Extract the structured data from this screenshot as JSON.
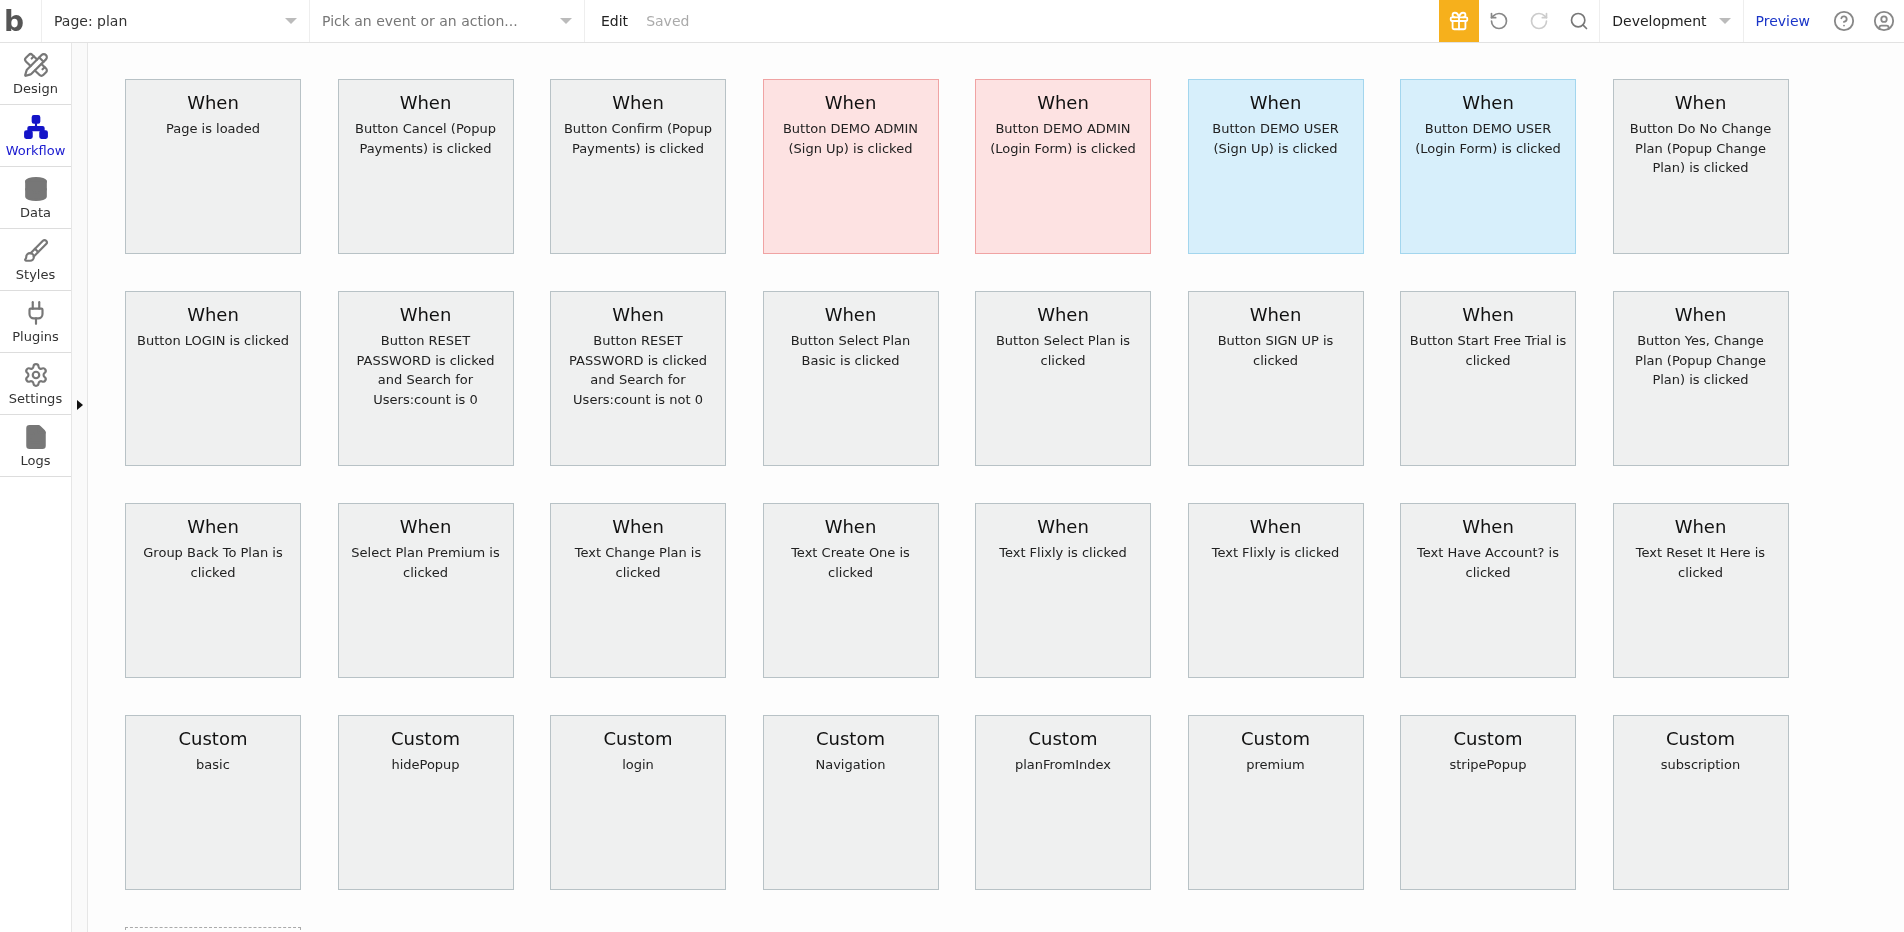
{
  "topbar": {
    "logo": "b",
    "page_selector": "Page: plan",
    "event_picker": {
      "placeholder": "Pick an event or an action..."
    },
    "edit": "Edit",
    "status": "Saved",
    "environment": "Development",
    "preview": "Preview"
  },
  "sidebar": {
    "items": [
      {
        "label": "Design",
        "selected": false
      },
      {
        "label": "Workflow",
        "selected": true
      },
      {
        "label": "Data",
        "selected": false
      },
      {
        "label": "Styles",
        "selected": false
      },
      {
        "label": "Plugins",
        "selected": false
      },
      {
        "label": "Settings",
        "selected": false
      },
      {
        "label": "Logs",
        "selected": false
      }
    ]
  },
  "events": [
    {
      "heading": "When",
      "text": "Page is loaded",
      "color": "#eff0f0"
    },
    {
      "heading": "When",
      "text": "Button Cancel (Popup Payments) is clicked",
      "color": "#eff0f0"
    },
    {
      "heading": "When",
      "text": "Button Confirm (Popup Payments) is clicked",
      "color": "#eff0f0"
    },
    {
      "heading": "When",
      "text": "Button DEMO ADMIN (Sign Up) is clicked",
      "color": "#fde2e2"
    },
    {
      "heading": "When",
      "text": "Button DEMO ADMIN (Login Form) is clicked",
      "color": "#fde2e2"
    },
    {
      "heading": "When",
      "text": "Button DEMO USER (Sign Up) is clicked",
      "color": "#d7effb"
    },
    {
      "heading": "When",
      "text": "Button DEMO USER (Login Form) is clicked",
      "color": "#d7effb"
    },
    {
      "heading": "When",
      "text": "Button Do No Change Plan (Popup Change Plan) is clicked",
      "color": "#eff0f0"
    },
    {
      "heading": "When",
      "text": "Button LOGIN is clicked",
      "color": "#eff0f0"
    },
    {
      "heading": "When",
      "text": "Button RESET PASSWORD is clicked and Search for Users:count is 0",
      "color": "#eff0f0"
    },
    {
      "heading": "When",
      "text": "Button RESET PASSWORD is clicked and Search for Users:count is not 0",
      "color": "#eff0f0"
    },
    {
      "heading": "When",
      "text": "Button Select Plan Basic is clicked",
      "color": "#eff0f0"
    },
    {
      "heading": "When",
      "text": "Button Select Plan is clicked",
      "color": "#eff0f0"
    },
    {
      "heading": "When",
      "text": "Button SIGN UP is clicked",
      "color": "#eff0f0"
    },
    {
      "heading": "When",
      "text": "Button Start Free Trial is clicked",
      "color": "#eff0f0"
    },
    {
      "heading": "When",
      "text": "Button Yes, Change Plan (Popup Change Plan) is clicked",
      "color": "#eff0f0"
    },
    {
      "heading": "When",
      "text": "Group Back To Plan is clicked",
      "color": "#eff0f0"
    },
    {
      "heading": "When",
      "text": "Select Plan Premium is clicked",
      "color": "#eff0f0"
    },
    {
      "heading": "When",
      "text": "Text Change Plan is clicked",
      "color": "#eff0f0"
    },
    {
      "heading": "When",
      "text": "Text Create One is clicked",
      "color": "#eff0f0"
    },
    {
      "heading": "When",
      "text": "Text Flixly is clicked",
      "color": "#eff0f0"
    },
    {
      "heading": "When",
      "text": "Text Flixly is clicked",
      "color": "#eff0f0"
    },
    {
      "heading": "When",
      "text": "Text Have Account? is clicked",
      "color": "#eff0f0"
    },
    {
      "heading": "When",
      "text": "Text Reset It Here is clicked",
      "color": "#eff0f0"
    },
    {
      "heading": "Custom",
      "text": "basic",
      "color": "#eff0f0"
    },
    {
      "heading": "Custom",
      "text": "hidePopup",
      "color": "#eff0f0"
    },
    {
      "heading": "Custom",
      "text": "login",
      "color": "#eff0f0"
    },
    {
      "heading": "Custom",
      "text": "Navigation",
      "color": "#eff0f0"
    },
    {
      "heading": "Custom",
      "text": "planFromIndex",
      "color": "#eff0f0"
    },
    {
      "heading": "Custom",
      "text": "premium",
      "color": "#eff0f0"
    },
    {
      "heading": "Custom",
      "text": "stripePopup",
      "color": "#eff0f0"
    },
    {
      "heading": "Custom",
      "text": "subscription",
      "color": "#eff0f0"
    }
  ]
}
